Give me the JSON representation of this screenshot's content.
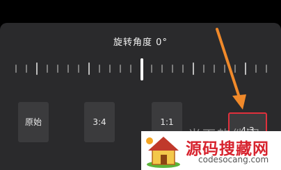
{
  "header": {
    "title": "旋转角度 0°"
  },
  "ruler": {
    "angle_value": 0
  },
  "ratios": [
    {
      "label": "原始",
      "selected": false
    },
    {
      "label": "3:4",
      "selected": false
    },
    {
      "label": "1:1",
      "selected": false
    },
    {
      "label": "4:3",
      "selected": true
    }
  ],
  "overlay": {
    "faint_text": "光下软件园",
    "watermark_title": "源码搜藏网",
    "watermark_url": "codesocang.com"
  },
  "colors": {
    "panel": "#2a2a2c",
    "selected_border": "#e0303c",
    "arrow": "#f0892a",
    "watermark_red": "#d7232e"
  },
  "icons": [
    "arrow-annotation-icon",
    "house-logo-icon"
  ]
}
